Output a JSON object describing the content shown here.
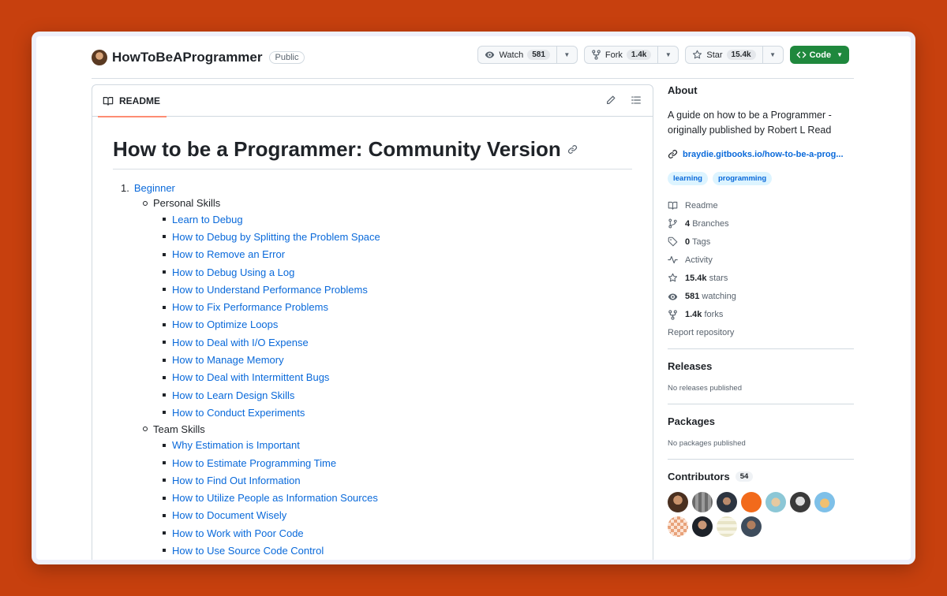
{
  "repo": {
    "name": "HowToBeAProgrammer",
    "visibility": "Public"
  },
  "actions": {
    "watch": {
      "label": "Watch",
      "count": "581"
    },
    "fork": {
      "label": "Fork",
      "count": "1.4k"
    },
    "star": {
      "label": "Star",
      "count": "15.4k"
    },
    "code": {
      "label": "Code"
    }
  },
  "readme": {
    "tab_label": "README",
    "title": "How to be a Programmer: Community Version",
    "toc": {
      "number": "1.",
      "section": "Beginner",
      "groups": [
        {
          "title": "Personal Skills",
          "items": [
            "Learn to Debug",
            "How to Debug by Splitting the Problem Space",
            "How to Remove an Error",
            "How to Debug Using a Log",
            "How to Understand Performance Problems",
            "How to Fix Performance Problems",
            "How to Optimize Loops",
            "How to Deal with I/O Expense",
            "How to Manage Memory",
            "How to Deal with Intermittent Bugs",
            "How to Learn Design Skills",
            "How to Conduct Experiments"
          ]
        },
        {
          "title": "Team Skills",
          "items": [
            "Why Estimation is Important",
            "How to Estimate Programming Time",
            "How to Find Out Information",
            "How to Utilize People as Information Sources",
            "How to Document Wisely",
            "How to Work with Poor Code",
            "How to Use Source Code Control"
          ]
        }
      ]
    }
  },
  "about": {
    "heading": "About",
    "description": "A guide on how to be a Programmer - originally published by Robert L Read",
    "link": "braydie.gitbooks.io/how-to-be-a-prog...",
    "topics": [
      "learning",
      "programming"
    ],
    "stats": {
      "readme": "Readme",
      "branches_count": "4",
      "branches_label": "Branches",
      "tags_count": "0",
      "tags_label": "Tags",
      "activity": "Activity",
      "stars_count": "15.4k",
      "stars_label": "stars",
      "watching_count": "581",
      "watching_label": "watching",
      "forks_count": "1.4k",
      "forks_label": "forks"
    },
    "report": "Report repository"
  },
  "releases": {
    "heading": "Releases",
    "empty": "No releases published"
  },
  "packages": {
    "heading": "Packages",
    "empty": "No packages published"
  },
  "contributors": {
    "heading": "Contributors",
    "count": "54"
  },
  "colors": {
    "link": "#0969da",
    "code_button": "#1f883d",
    "tab_underline": "#fd8c73",
    "background": "#c7400e"
  }
}
